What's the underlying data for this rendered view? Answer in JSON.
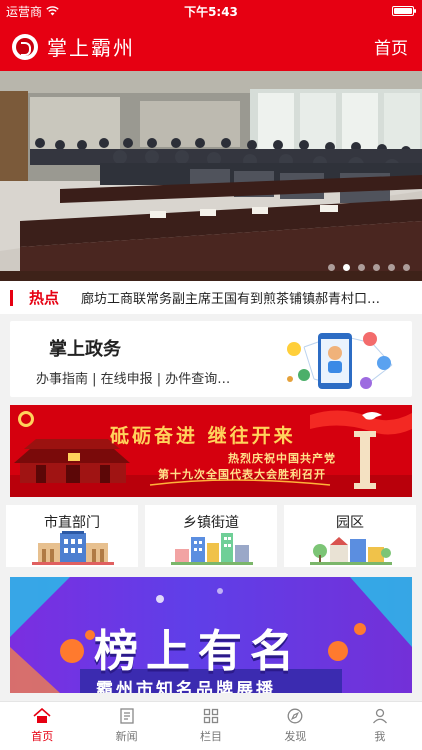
{
  "status": {
    "carrier": "运营商",
    "time": "下午5:43"
  },
  "header": {
    "title": "掌上霸州",
    "home_link": "首页"
  },
  "carousel": {
    "slide_count": 6,
    "active_index": 1
  },
  "hot": {
    "tag": "热点",
    "headline": "廊坊工商联常务副主席王国有到煎茶铺镇郝青村口…"
  },
  "gov": {
    "title": "掌上政务",
    "subtitle": "办事指南 | 在线申报 | 办件查询…"
  },
  "promo": {
    "slogan": "砥砺奋进  继往开来",
    "line1": "热烈庆祝中国共产党",
    "line2": "第十九次全国代表大会胜利召开"
  },
  "categories": [
    {
      "label": "市直部门"
    },
    {
      "label": "乡镇街道"
    },
    {
      "label": "园区"
    }
  ],
  "promo2": {
    "title": "榜上有名",
    "subtitle": "霸州市知名品牌展播"
  },
  "tabs": [
    {
      "label": "首页",
      "icon": "home-icon",
      "active": true
    },
    {
      "label": "新闻",
      "icon": "news-icon",
      "active": false
    },
    {
      "label": "栏目",
      "icon": "grid-icon",
      "active": false
    },
    {
      "label": "发现",
      "icon": "compass-icon",
      "active": false
    },
    {
      "label": "我",
      "icon": "user-icon",
      "active": false
    }
  ],
  "colors": {
    "brand_red": "#e60012",
    "tab_inactive": "#777777"
  }
}
